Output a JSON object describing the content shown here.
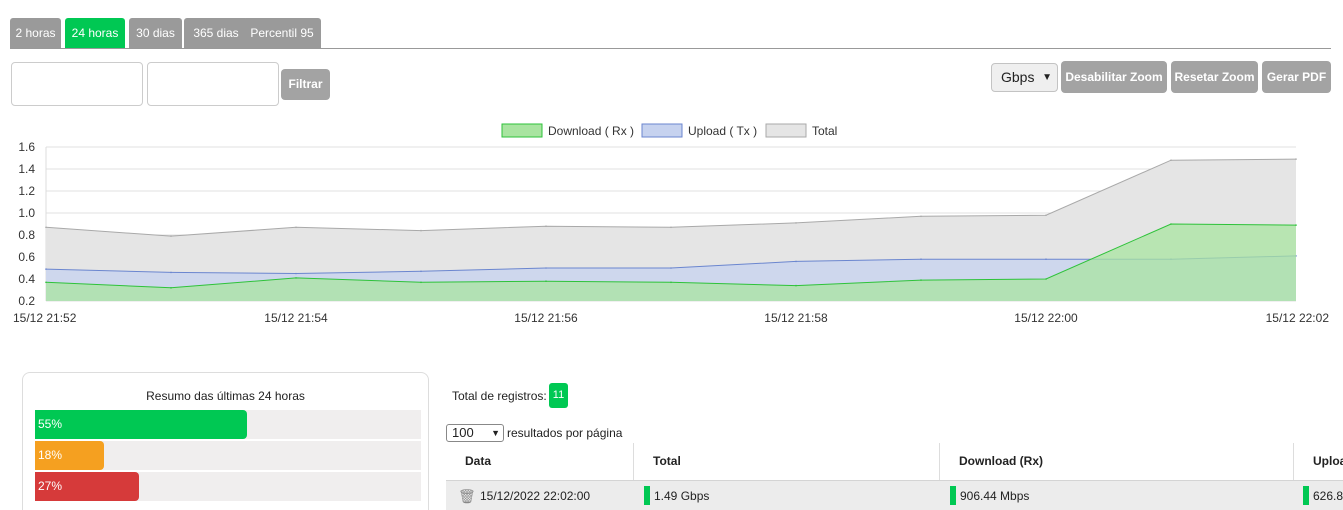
{
  "tabs": [
    {
      "label": "2 horas",
      "active": false
    },
    {
      "label": "24 horas",
      "active": true
    },
    {
      "label": "30 dias",
      "active": false
    },
    {
      "label": "365 dias",
      "active": false
    },
    {
      "label": "Percentil 95",
      "active": false
    }
  ],
  "filter": {
    "button_label": "Filtrar",
    "start_value": "",
    "end_value": ""
  },
  "toolbar": {
    "unit_selected": "Gbps",
    "disable_zoom_label": "Desabilitar Zoom",
    "reset_zoom_label": "Resetar Zoom",
    "pdf_label": "Gerar PDF"
  },
  "colors": {
    "accent": "#00c853",
    "tab_inactive": "#9a9a9a",
    "download_fill": "#a8e4a0",
    "download_line": "#2ec23a",
    "upload_fill": "#c6d2ef",
    "upload_line": "#6b86cf",
    "total_fill": "#e5e5e5",
    "total_line": "#a9a9a9",
    "warn": "#f5a020",
    "danger": "#d63a3a"
  },
  "chart_data": {
    "type": "area",
    "title": "",
    "xlabel": "",
    "ylabel": "",
    "ylim": [
      0.2,
      1.6
    ],
    "yticks": [
      "1.6",
      "1.4",
      "1.2",
      "1.0",
      "0.8",
      "0.6",
      "0.4",
      "0.2"
    ],
    "xtick_labels": [
      "15/12 21:52",
      "15/12 21:54",
      "15/12 21:56",
      "15/12 21:58",
      "15/12 22:00",
      "15/12 22:02"
    ],
    "x": [
      "21:52",
      "21:53",
      "21:54",
      "21:55",
      "21:56",
      "21:57",
      "21:58",
      "21:59",
      "22:00",
      "22:01",
      "22:02"
    ],
    "grid": true,
    "legend_position": "top-center",
    "series": [
      {
        "name": "Download ( Rx )",
        "values": [
          0.37,
          0.32,
          0.41,
          0.37,
          0.38,
          0.37,
          0.34,
          0.39,
          0.4,
          0.9,
          0.89
        ]
      },
      {
        "name": "Upload ( Tx )",
        "values": [
          0.49,
          0.46,
          0.45,
          0.47,
          0.5,
          0.5,
          0.56,
          0.58,
          0.58,
          0.58,
          0.61
        ]
      },
      {
        "name": "Total",
        "values": [
          0.87,
          0.79,
          0.87,
          0.84,
          0.88,
          0.87,
          0.91,
          0.97,
          0.98,
          1.48,
          1.49
        ]
      }
    ]
  },
  "summary": {
    "title": "Resumo das últimas 24 horas",
    "bars": [
      {
        "label": "55%",
        "value": 55,
        "color": "#00c853"
      },
      {
        "label": "18%",
        "value": 18,
        "color": "#f5a020"
      },
      {
        "label": "27%",
        "value": 27,
        "color": "#d63a3a"
      }
    ]
  },
  "records": {
    "total_label": "Total de registros:",
    "total_count": "11",
    "page_size": "100",
    "per_page_label": "resultados por página",
    "columns": [
      "Data",
      "Total",
      "Download (Rx)",
      "Uploa"
    ],
    "rows": [
      {
        "date": "15/12/2022 22:02:00",
        "total": "1.49 Gbps",
        "download": "906.44 Mbps",
        "upload": "626.8"
      }
    ]
  }
}
